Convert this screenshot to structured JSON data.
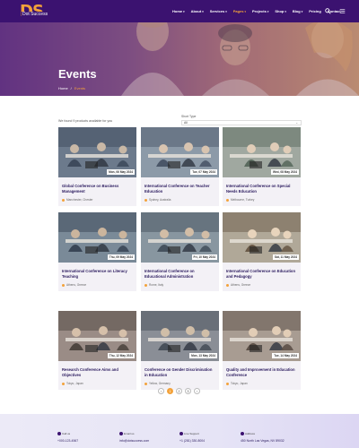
{
  "brand": {
    "mark": "DS",
    "name": "Dot Success"
  },
  "nav": {
    "items": [
      {
        "label": "Home",
        "has_menu": true
      },
      {
        "label": "About",
        "has_menu": true
      },
      {
        "label": "Services",
        "has_menu": true
      },
      {
        "label": "Pages",
        "has_menu": true,
        "active": true
      },
      {
        "label": "Projects",
        "has_menu": true
      },
      {
        "label": "Shop",
        "has_menu": true
      },
      {
        "label": "Blog",
        "has_menu": true
      },
      {
        "label": "Pricing",
        "has_menu": false
      },
      {
        "label": "Contact",
        "has_menu": false
      }
    ]
  },
  "hero": {
    "title": "Events",
    "breadcrumb": {
      "home": "Home",
      "current": "Events"
    }
  },
  "toolbar": {
    "results_text": "We found 9 products available for you",
    "sort_label": "Short Type",
    "sort_value": "All"
  },
  "events": [
    {
      "title": "Global Conference on Business Management",
      "date": "Mon, 06 May 2024",
      "location": "Manchester, Chester"
    },
    {
      "title": "International Conference on Teacher Education",
      "date": "Tue, 07 May 2024",
      "location": "Sydney, Australia"
    },
    {
      "title": "International Conference on Special Needs Education",
      "date": "Wed, 08 May 2024",
      "location": "Melbourne, Turkey"
    },
    {
      "title": "International Conference on Literacy Teaching",
      "date": "Thu, 09 May 2024",
      "location": "Athens, Greece"
    },
    {
      "title": "International Conference on Educational Administration",
      "date": "Fri, 10 May 2024",
      "location": "Rome, Italy"
    },
    {
      "title": "International Conference on Education and Pedagogy",
      "date": "Sat, 11 May 2024",
      "location": "Athens, Greece"
    },
    {
      "title": "Research Conference Aims and Objectives",
      "date": "Thu, 12 May 2024",
      "location": "Tokyo, Japan"
    },
    {
      "title": "Conference on Gender Discrimination in Education",
      "date": "Mon, 13 May 2024",
      "location": "Yellow, Germany"
    },
    {
      "title": "Quality and Improvement in Education Conference",
      "date": "Tue, 14 May 2024",
      "location": "Tokyo, Japan"
    }
  ],
  "pagination": {
    "prev": "‹",
    "pages": [
      "1",
      "2",
      "3"
    ],
    "current": "1",
    "next": "›"
  },
  "footer": {
    "phone": {
      "label": "Call us",
      "value": "+000-123-4567",
      "icon": "phone-icon"
    },
    "email": {
      "label": "Email us",
      "value": "info@dotsuccess.com",
      "icon": "mail-icon"
    },
    "support": {
      "label": "Live Support",
      "value": "+1 (281) 330-8004",
      "icon": "headset-icon"
    },
    "address": {
      "label": "Address",
      "value": "450 North Las Vegas, NV 89032",
      "icon": "location-icon"
    }
  },
  "colors": {
    "header": "#3b1270",
    "accent": "#f3a23a",
    "title": "#2a1a5e",
    "card_bg": "#f3f1f6"
  }
}
